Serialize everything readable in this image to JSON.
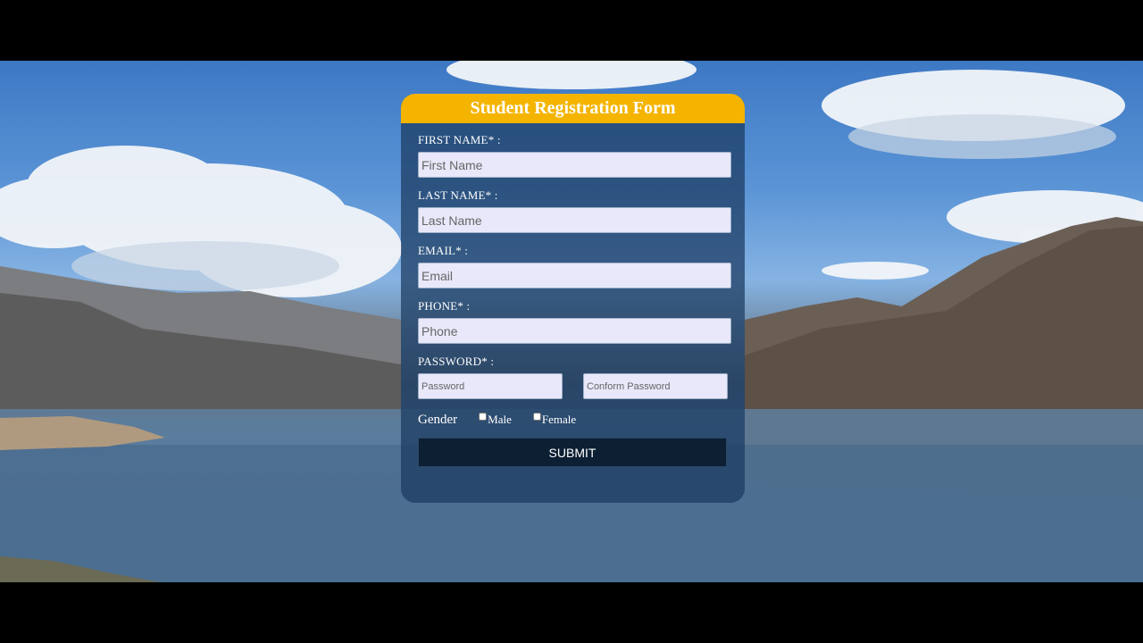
{
  "form": {
    "title": "Student Registration Form",
    "first_name": {
      "label": "FIRST NAME* :",
      "placeholder": "First Name"
    },
    "last_name": {
      "label": "LAST NAME* :",
      "placeholder": "Last Name"
    },
    "email": {
      "label": "EMAIL* :",
      "placeholder": "Email"
    },
    "phone": {
      "label": "PHONE* :",
      "placeholder": "Phone"
    },
    "password": {
      "label": "PASSWORD* :",
      "placeholder": "Password",
      "confirm_placeholder": "Conform Password"
    },
    "gender": {
      "label": "Gender",
      "options": [
        "Male",
        "Female"
      ]
    },
    "submit_label": "SUBMIT"
  },
  "colors": {
    "header": "#f4b400",
    "card": "#1a3a5f",
    "field": "#e8e8fa",
    "button": "#0c1f33"
  }
}
